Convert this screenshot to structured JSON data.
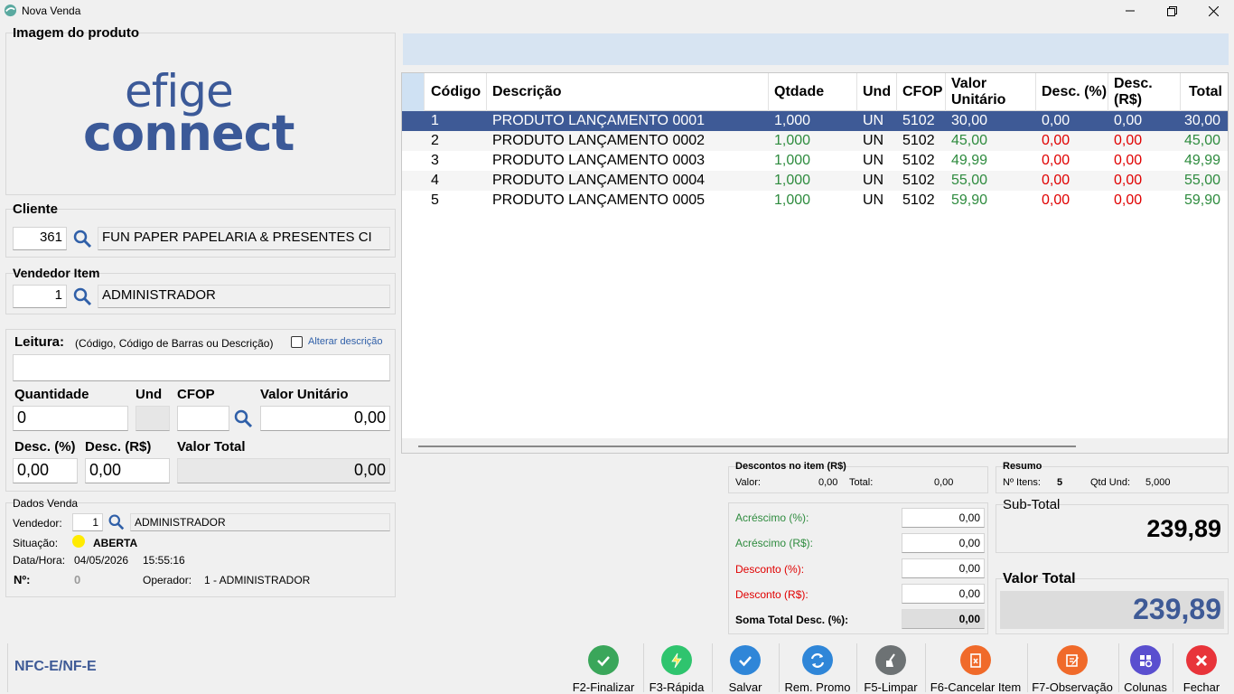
{
  "window": {
    "title": "Nova Venda"
  },
  "product_image": {
    "title": "Imagem do produto",
    "logo_line1": "efige",
    "logo_line2": "connect"
  },
  "cliente": {
    "title": "Cliente",
    "code": "361",
    "name": "FUN PAPER PAPELARIA & PRESENTES CI"
  },
  "vendedor_item": {
    "title": "Vendedor Item",
    "code": "1",
    "name": "ADMINISTRADOR"
  },
  "leitura": {
    "title": "Leitura:",
    "hint": "(Código, Código de Barras ou Descrição)",
    "alterar_label": "Alterar descrição",
    "alterar_checked": false,
    "input_value": "",
    "quantidade_label": "Quantidade",
    "quantidade_value": "0",
    "und_label": "Und",
    "und_value": "",
    "cfop_label": "CFOP",
    "cfop_value": "",
    "valor_unitario_label": "Valor Unitário",
    "valor_unitario_value": "0,00",
    "desc_pct_label": "Desc. (%)",
    "desc_pct_value": "0,00",
    "desc_rs_label": "Desc. (R$)",
    "desc_rs_value": "0,00",
    "valor_total_label": "Valor Total",
    "valor_total_value": "0,00"
  },
  "dados_venda": {
    "title": "Dados Venda",
    "vendedor_label": "Vendedor:",
    "vendedor_code": "1",
    "vendedor_name": "ADMINISTRADOR",
    "situacao_label": "Situação:",
    "situacao_value": "ABERTA",
    "situacao_color": "#ffeb00",
    "datahora_label": "Data/Hora:",
    "date": "04/05/2026",
    "time": "15:55:16",
    "numero_label": "Nº:",
    "numero_value": "0",
    "operador_label": "Operador:",
    "operador_value": "1 - ADMINISTRADOR"
  },
  "grid": {
    "headers": [
      "Código",
      "Descrição",
      "Qtdade",
      "Und",
      "CFOP",
      "Valor Unitário",
      "Desc. (%)",
      "Desc. (R$)",
      "Total"
    ],
    "rows": [
      {
        "codigo": "1",
        "descricao": "PRODUTO LANÇAMENTO 0001",
        "qtdade": "1,000",
        "und": "UN",
        "cfop": "5102",
        "valor_unit": "30,00",
        "desc_pct": "0,00",
        "desc_rs": "0,00",
        "total": "30,00",
        "selected": true
      },
      {
        "codigo": "2",
        "descricao": "PRODUTO LANÇAMENTO 0002",
        "qtdade": "1,000",
        "und": "UN",
        "cfop": "5102",
        "valor_unit": "45,00",
        "desc_pct": "0,00",
        "desc_rs": "0,00",
        "total": "45,00",
        "selected": false
      },
      {
        "codigo": "3",
        "descricao": "PRODUTO LANÇAMENTO 0003",
        "qtdade": "1,000",
        "und": "UN",
        "cfop": "5102",
        "valor_unit": "49,99",
        "desc_pct": "0,00",
        "desc_rs": "0,00",
        "total": "49,99",
        "selected": false
      },
      {
        "codigo": "4",
        "descricao": "PRODUTO LANÇAMENTO 0004",
        "qtdade": "1,000",
        "und": "UN",
        "cfop": "5102",
        "valor_unit": "55,00",
        "desc_pct": "0,00",
        "desc_rs": "0,00",
        "total": "55,00",
        "selected": false
      },
      {
        "codigo": "5",
        "descricao": "PRODUTO LANÇAMENTO 0005",
        "qtdade": "1,000",
        "und": "UN",
        "cfop": "5102",
        "valor_unit": "59,90",
        "desc_pct": "0,00",
        "desc_rs": "0,00",
        "total": "59,90",
        "selected": false
      }
    ]
  },
  "descontos_item": {
    "title": "Descontos no item (R$)",
    "valor_label": "Valor:",
    "valor_value": "0,00",
    "total_label": "Total:",
    "total_value": "0,00"
  },
  "ajustes": {
    "acrescimo_pct_label": "Acréscimo (%):",
    "acrescimo_pct_value": "0,00",
    "acrescimo_rs_label": "Acréscimo (R$):",
    "acrescimo_rs_value": "0,00",
    "desconto_pct_label": "Desconto (%):",
    "desconto_pct_value": "0,00",
    "desconto_rs_label": "Desconto (R$):",
    "desconto_rs_value": "0,00",
    "soma_label": "Soma Total Desc. (%):",
    "soma_value": "0,00"
  },
  "resumo": {
    "title": "Resumo",
    "itens_label": "Nº Itens:",
    "itens_value": "5",
    "qtd_label": "Qtd Und:",
    "qtd_value": "5,000"
  },
  "subtotal": {
    "label": "Sub-Total",
    "value": "239,89"
  },
  "valor_total": {
    "label": "Valor Total",
    "value": "239,89"
  },
  "footer": {
    "mode": "NFC-E/NF-E"
  },
  "toolbar": {
    "finalizar": "F2-Finalizar",
    "rapida": "F3-Rápida",
    "salvar": "Salvar",
    "rem_promo": "Rem. Promo",
    "limpar": "F5-Limpar",
    "cancelar_item": "F6-Cancelar Item",
    "observacao": "F7-Observação",
    "colunas": "Colunas",
    "fechar": "Fechar"
  },
  "colors": {
    "accent": "#3e5a96",
    "green": "#2e8b3e",
    "red": "#e00000",
    "logo": "#3b5998"
  }
}
